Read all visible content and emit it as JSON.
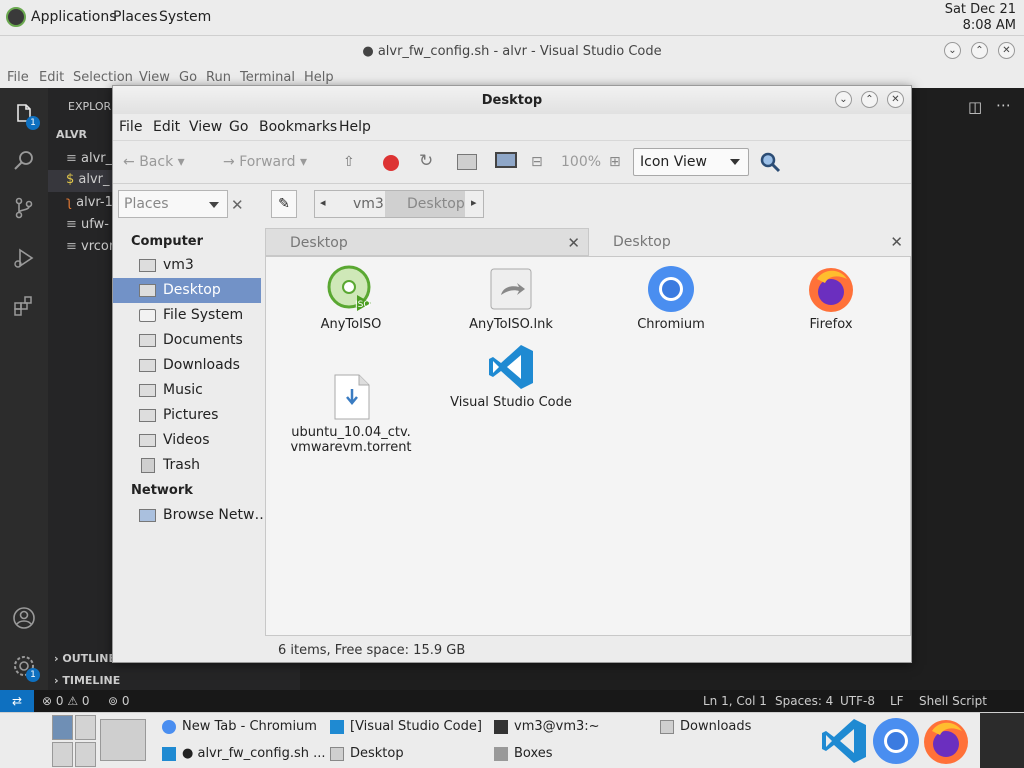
{
  "top_panel": {
    "menus": [
      "Applications",
      "Places",
      "System"
    ],
    "clock_date": "Sat Dec 21",
    "clock_time": "8:08 AM"
  },
  "vscode": {
    "title": "● alvr_fw_config.sh - alvr - Visual Studio Code",
    "menu": [
      "File",
      "Edit",
      "Selection",
      "View",
      "Go",
      "Run",
      "Terminal",
      "Help"
    ],
    "explorer_label": "EXPLORER",
    "folder_label": "ALVR",
    "files": [
      "alvr_",
      "alvr_",
      "alvr-1",
      "ufw-",
      "vrcon"
    ],
    "outline_label": "OUTLINE",
    "timeline_label": "TIMELINE",
    "explorer_badge": "1",
    "settings_badge": "1",
    "status": {
      "errors": "0",
      "warnings": "0",
      "ports": "0",
      "position": "Ln 1, Col 1",
      "spaces": "Spaces: 4",
      "encoding": "UTF-8",
      "eol": "LF",
      "language": "Shell Script"
    }
  },
  "file_manager": {
    "title": "Desktop",
    "menu": [
      "File",
      "Edit",
      "View",
      "Go",
      "Bookmarks",
      "Help"
    ],
    "toolbar": {
      "back": "Back",
      "forward": "Forward",
      "zoom": "100%",
      "view_mode": "Icon View"
    },
    "places_combo": "Places",
    "breadcrumbs": [
      "vm3",
      "Desktop"
    ],
    "sidebar": {
      "computer_header": "Computer",
      "computer_items": [
        "vm3",
        "Desktop",
        "File System",
        "Documents",
        "Downloads",
        "Music",
        "Pictures",
        "Videos",
        "Trash"
      ],
      "selected": "Desktop",
      "network_header": "Network",
      "network_items": [
        "Browse Netw…"
      ]
    },
    "tabs": [
      "Desktop",
      "Desktop"
    ],
    "files": [
      {
        "name": "AnyToISO",
        "icon": "anytoiso-icon"
      },
      {
        "name": "AnyToISO.lnk",
        "icon": "shortcut-icon"
      },
      {
        "name": "Chromium",
        "icon": "chromium-icon"
      },
      {
        "name": "Firefox",
        "icon": "firefox-icon"
      },
      {
        "name": "ubuntu_10.04_ctv.\nvmwarevm.torrent",
        "icon": "torrent-file-icon"
      },
      {
        "name": "Visual Studio Code",
        "icon": "vscode-icon"
      }
    ],
    "status": "6 items, Free space: 15.9 GB"
  },
  "taskbar": {
    "tasks": [
      "New Tab - Chromium",
      "[Visual Studio Code]",
      "vm3@vm3:~",
      "Downloads",
      "● alvr_fw_config.sh ...",
      "Desktop",
      "Boxes"
    ]
  },
  "colors": {
    "selection": "#7292c7",
    "vscode_blue": "#0e70c0",
    "chromium_blue": "#4a8ef0",
    "firefox_orange": "#ff7139"
  }
}
